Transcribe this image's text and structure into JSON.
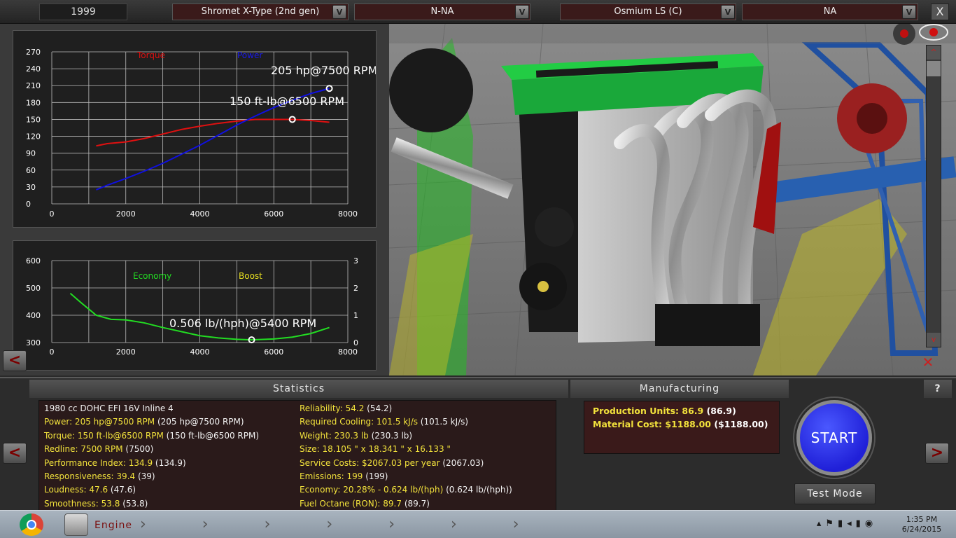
{
  "topbar": {
    "year": "1999",
    "dropdowns": [
      {
        "value": "Shromet X-Type (2nd gen)"
      },
      {
        "value": "N-NA"
      },
      {
        "value": "Osmium LS (C)"
      },
      {
        "value": "NA"
      }
    ],
    "dropdown_arrow": "V",
    "close_label": "X"
  },
  "power_chart": {
    "legend_torque": "Torque",
    "legend_power": "Power",
    "annotation_power": "205 hp@7500 RPM",
    "annotation_torque": "150 ft-lb@6500 RPM",
    "y_ticks": [
      "270",
      "240",
      "210",
      "180",
      "150",
      "120",
      "90",
      "60",
      "30",
      "0"
    ],
    "x_ticks": [
      "0",
      "2000",
      "4000",
      "6000",
      "8000"
    ]
  },
  "economy_chart": {
    "legend_economy": "Economy",
    "legend_boost": "Boost",
    "annotation": "0.506 lb/(hph)@5400 RPM",
    "y_left_ticks": [
      "600",
      "500",
      "400",
      "300"
    ],
    "y_right_ticks": [
      "3",
      "2",
      "1",
      "0"
    ],
    "x_ticks": [
      "0",
      "2000",
      "4000",
      "6000",
      "8000"
    ]
  },
  "chart_data": [
    {
      "type": "line",
      "title": "",
      "xlabel": "",
      "ylabel": "",
      "xlim": [
        0,
        8000
      ],
      "ylim": [
        0,
        270
      ],
      "grid": true,
      "series": [
        {
          "name": "Torque",
          "color": "#e01010",
          "x": [
            1200,
            1500,
            2000,
            2500,
            3000,
            3500,
            4000,
            4500,
            5000,
            5500,
            6000,
            6500,
            7000,
            7500
          ],
          "values": [
            103,
            107,
            110,
            116,
            124,
            132,
            138,
            143,
            147,
            150,
            150,
            150,
            148,
            145
          ]
        },
        {
          "name": "Power",
          "color": "#1010e0",
          "x": [
            1200,
            1500,
            2000,
            2500,
            3000,
            3500,
            4000,
            4500,
            5000,
            5500,
            6000,
            6500,
            7000,
            7500
          ],
          "values": [
            25,
            33,
            45,
            58,
            72,
            88,
            104,
            122,
            140,
            156,
            171,
            184,
            196,
            205
          ]
        }
      ],
      "markers": [
        {
          "x": 7500,
          "y": 205
        },
        {
          "x": 6500,
          "y": 150
        }
      ]
    },
    {
      "type": "line",
      "title": "",
      "xlabel": "",
      "ylabel": "",
      "xlim": [
        0,
        8000
      ],
      "ylim": [
        300,
        600
      ],
      "y2lim": [
        0,
        3
      ],
      "grid": true,
      "series": [
        {
          "name": "Economy",
          "color": "#22dd22",
          "x": [
            500,
            800,
            1200,
            1600,
            2000,
            2500,
            3000,
            3500,
            4000,
            4500,
            5000,
            5400,
            6000,
            6500,
            7000,
            7500
          ],
          "values": [
            480,
            445,
            400,
            385,
            383,
            372,
            355,
            340,
            325,
            317,
            312,
            310,
            313,
            320,
            333,
            355
          ]
        },
        {
          "name": "Boost",
          "color": "#e8e020",
          "x": [],
          "values": []
        }
      ],
      "markers": [
        {
          "x": 5400,
          "y": 310
        }
      ]
    }
  ],
  "nav": {
    "left": "<",
    "right": ">"
  },
  "statistics": {
    "header": "Statistics",
    "left": [
      {
        "k": "1980 cc DOHC EFI 16V Inline 4",
        "v": ""
      },
      {
        "k": "Power: 205 hp@7500 RPM",
        "v": " (205 hp@7500 RPM)"
      },
      {
        "k": "Torque: 150 ft-lb@6500 RPM",
        "v": " (150 ft-lb@6500 RPM)"
      },
      {
        "k": "Redline: 7500 RPM",
        "v": " (7500)"
      },
      {
        "k": "Performance Index: 134.9",
        "v": " (134.9)"
      },
      {
        "k": "Responsiveness: 39.4",
        "v": " (39)"
      },
      {
        "k": "Loudness: 47.6",
        "v": " (47.6)"
      },
      {
        "k": "Smoothness: 53.8",
        "v": " (53.8)"
      }
    ],
    "right": [
      {
        "k": "Reliability: 54.2",
        "v": " (54.2)"
      },
      {
        "k": "Required Cooling: 101.5 kJ/s",
        "v": " (101.5 kJ/s)"
      },
      {
        "k": "Weight: 230.3 lb",
        "v": " (230.3 lb)"
      },
      {
        "k": "Size: 18.105 \" x 18.341 \" x 16.133 \"",
        "v": ""
      },
      {
        "k": "Service Costs: $2067.03 per year",
        "v": " (2067.03)"
      },
      {
        "k": "Emissions: 199",
        "v": " (199)"
      },
      {
        "k": "Economy: 20.28% - 0.624 lb/(hph)",
        "v": " (0.624 lb/(hph))"
      },
      {
        "k": "Fuel Octane (RON): 89.7",
        "v": " (89.7)"
      }
    ]
  },
  "manufacturing": {
    "header": "Manufacturing",
    "lines": [
      {
        "k": "Production Units: 86.9",
        "v": " (86.9)"
      },
      {
        "k": "Material Cost: $1188.00",
        "v": " ($1188.00)"
      }
    ]
  },
  "help_label": "?",
  "start_label": "START",
  "test_mode_label": "Test Mode",
  "taskbar": {
    "engine_label": "Engine",
    "time": "1:35 PM",
    "date": "6/24/2015"
  },
  "colors": {
    "accent_yellow": "#f2e23c",
    "start_blue": "#2828e8",
    "torque": "#e01010",
    "power": "#1010e0",
    "economy": "#22dd22"
  }
}
